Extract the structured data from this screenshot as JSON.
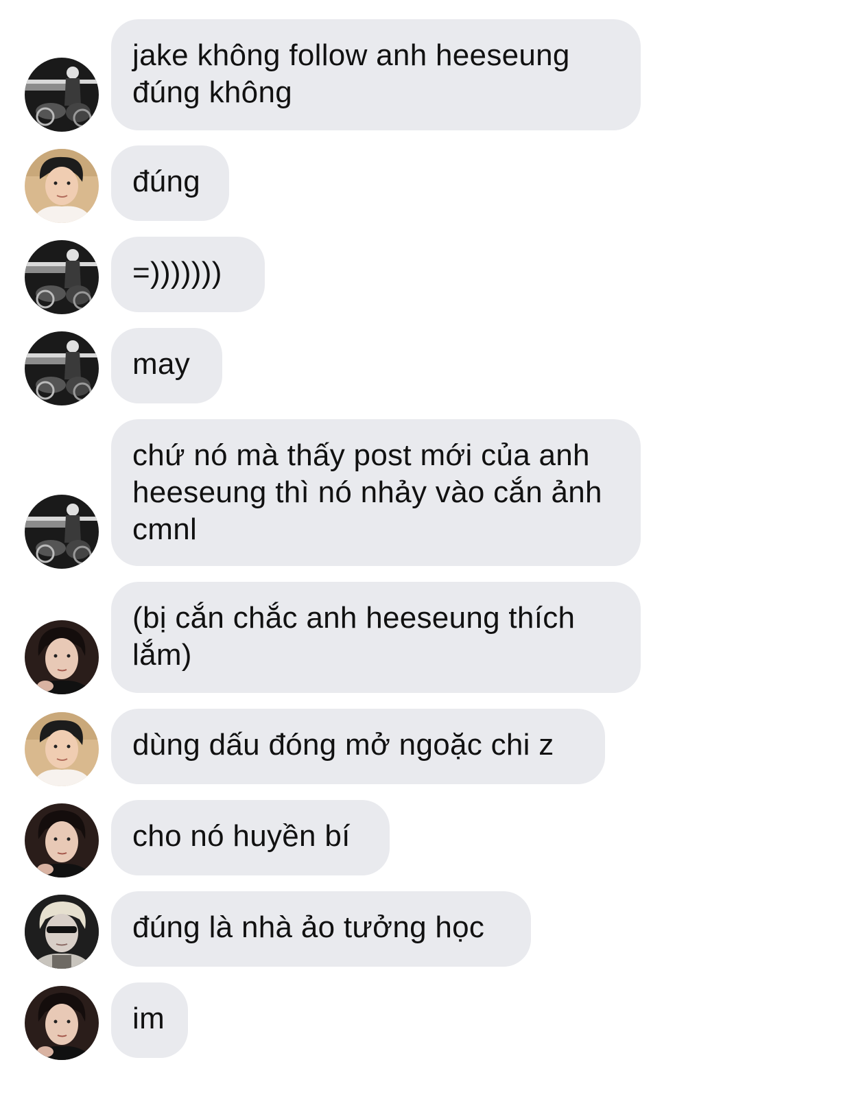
{
  "messages": [
    {
      "avatar": "avatar-bw-motorcycle",
      "text": "jake không follow anh heeseung\nđúng không"
    },
    {
      "avatar": "avatar-beach-boy",
      "text": "đúng"
    },
    {
      "avatar": "avatar-bw-motorcycle",
      "text": "=)))))))"
    },
    {
      "avatar": "avatar-bw-motorcycle",
      "text": "may"
    },
    {
      "avatar": "avatar-bw-motorcycle",
      "text": "chứ nó mà thấy post mới của anh\nheeseung thì nó nhảy vào cắn ảnh\ncmnl"
    },
    {
      "avatar": "avatar-dark-portrait",
      "text": "(bị cắn chắc anh heeseung thích\nlắm)"
    },
    {
      "avatar": "avatar-beach-boy",
      "text": "dùng dấu đóng mở ngoặc chi z"
    },
    {
      "avatar": "avatar-dark-portrait",
      "text": "cho nó huyền bí"
    },
    {
      "avatar": "avatar-blond-sunglasses",
      "text": "đúng là nhà ảo tưởng học"
    },
    {
      "avatar": "avatar-dark-portrait",
      "text": "im"
    }
  ],
  "colors": {
    "bubble_bg": "#e9eaee",
    "text": "#111111",
    "background": "#ffffff"
  }
}
